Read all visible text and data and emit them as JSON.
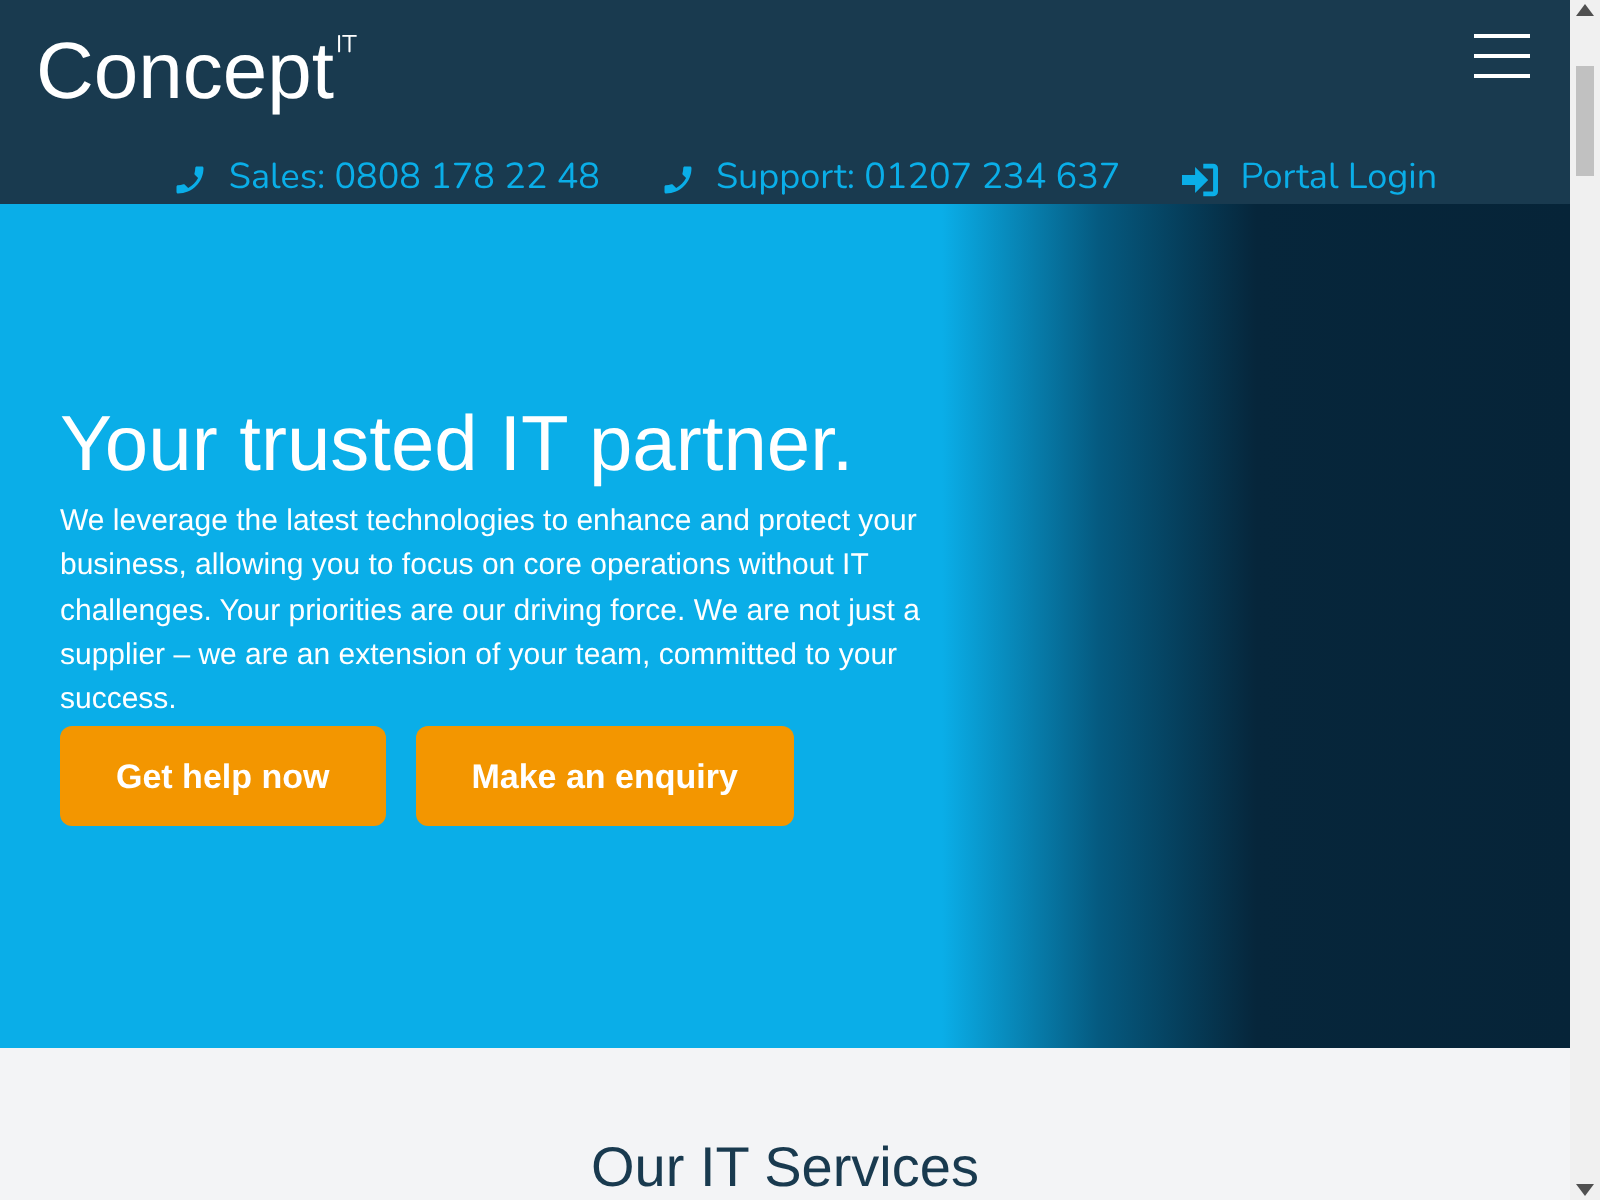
{
  "logo": {
    "name": "Concept",
    "superscript": "IT"
  },
  "contacts": [
    {
      "kind": "phone",
      "label": "Sales: 0808 178 22 48"
    },
    {
      "kind": "phone",
      "label": "Support: 01207 234 637"
    },
    {
      "kind": "login",
      "label": "Portal Login"
    }
  ],
  "hero": {
    "title": "Your trusted IT partner.",
    "text": "We leverage the latest technologies to enhance and protect your business, allowing you to focus on core operations without IT challenges. Your priorities are our driving force. We are not just a supplier – we are an extension of your team, committed to your success.",
    "buttons": [
      "Get help now",
      "Make an enquiry"
    ]
  },
  "services": {
    "title": "Our IT Services"
  }
}
